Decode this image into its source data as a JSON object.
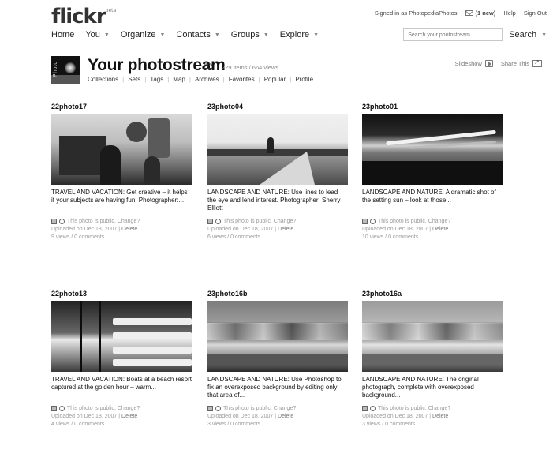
{
  "header": {
    "logo": "flickr",
    "logo_tag": "beta",
    "signed_in_prefix": "Signed in as",
    "user": "PhotopediaPhotos",
    "mail": "(1 new)",
    "help": "Help",
    "sign_out": "Sign Out"
  },
  "nav": {
    "items": [
      "Home",
      "You",
      "Organize",
      "Contacts",
      "Groups",
      "Explore"
    ],
    "search_placeholder": "Search your photostream",
    "search_button": "Search"
  },
  "photostream": {
    "buddy_label": "Photo",
    "title": "Your photostream",
    "pro": "pro",
    "stats": "229 items / 664 views",
    "links": [
      "Collections",
      "Sets",
      "Tags",
      "Map",
      "Archives",
      "Favorites",
      "Popular",
      "Profile"
    ],
    "slideshow": "Slideshow",
    "share": "Share This"
  },
  "photos": [
    {
      "title": "22photo17",
      "desc": "TRAVEL AND VACATION: Get creative – it helps if your subjects are having fun! Photographer:...",
      "privacy": "This photo is public. Change?",
      "uploaded": "Uploaded on Dec 18, 2007",
      "delete": "Delete",
      "views": "9 views / 0 comments"
    },
    {
      "title": "23photo04",
      "desc": "LANDSCAPE AND NATURE: Use lines to lead the eye and lend interest. Photographer: Sherry Elliott",
      "privacy": "This photo is public. Change?",
      "uploaded": "Uploaded on Dec 18, 2007",
      "delete": "Delete",
      "views": "6 views / 0 comments"
    },
    {
      "title": "23photo01",
      "desc": "LANDSCAPE AND NATURE: A dramatic shot of the setting sun – look at those...",
      "privacy": "This photo is public. Change?",
      "uploaded": "Uploaded on Dec 18, 2007",
      "delete": "Delete",
      "views": "10 views / 0 comments"
    },
    {
      "title": "22photo13",
      "desc": "TRAVEL AND VACATION: Boats at a beach resort captured at the golden hour – warm...",
      "privacy": "This photo is public. Change?",
      "uploaded": "Uploaded on Dec 18, 2007",
      "delete": "Delete",
      "views": "4 views / 0 comments"
    },
    {
      "title": "23photo16b",
      "desc": "LANDSCAPE AND NATURE: Use Photoshop to fix an overexposed background by editing only that area of...",
      "privacy": "This photo is public. Change?",
      "uploaded": "Uploaded on Dec 18, 2007",
      "delete": "Delete",
      "views": "3 views / 0 comments"
    },
    {
      "title": "23photo16a",
      "desc": "LANDSCAPE AND NATURE: The original photograph, complete with overexposed background...",
      "privacy": "This photo is public. Change?",
      "uploaded": "Uploaded on Dec 18, 2007",
      "delete": "Delete",
      "views": "3 views / 0 comments"
    }
  ]
}
